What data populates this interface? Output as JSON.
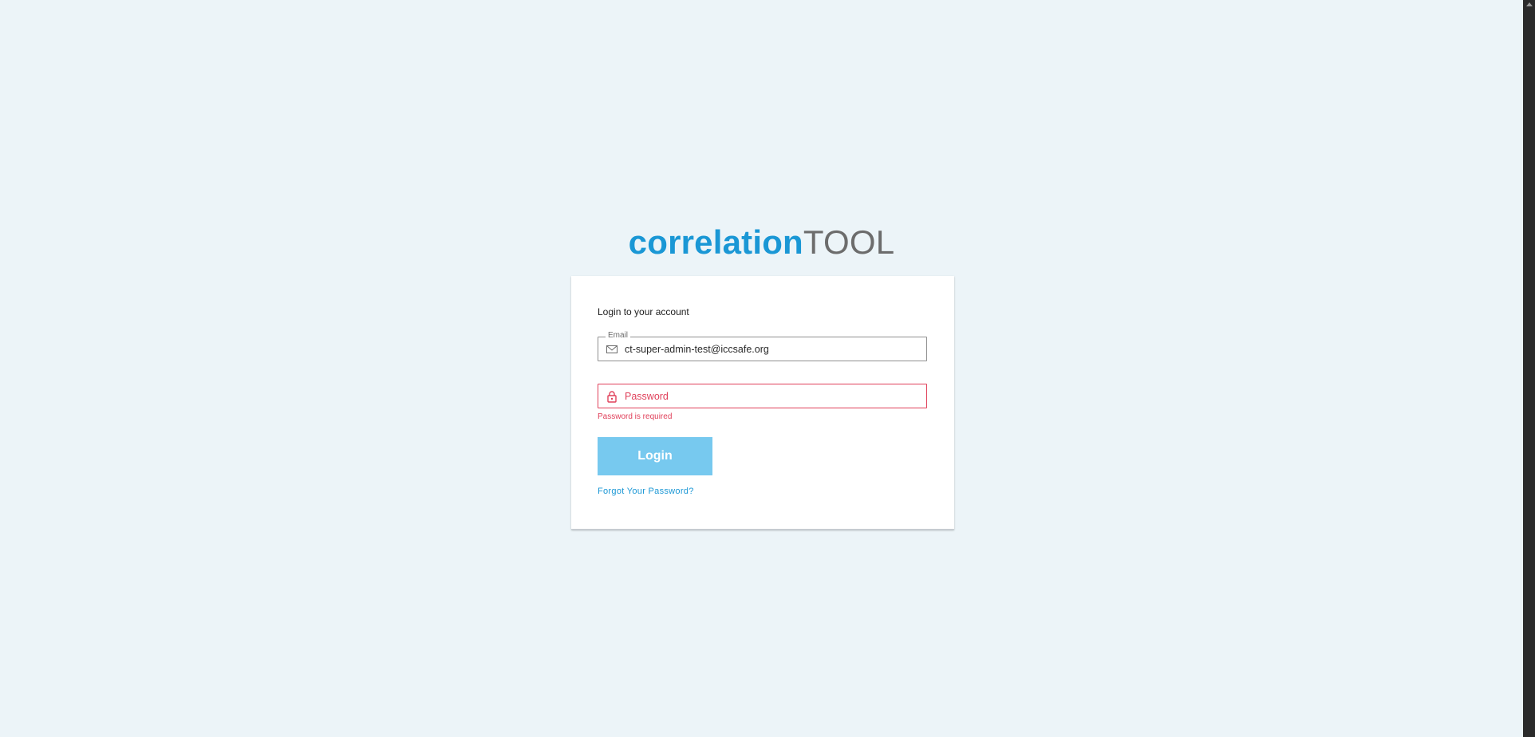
{
  "brand": {
    "main": "correlation",
    "sub": "TOOL"
  },
  "login": {
    "title": "Login to your account",
    "email": {
      "legend": "Email",
      "value": "ct-super-admin-test@iccsafe.org",
      "icon": "envelope-icon"
    },
    "password": {
      "placeholder": "Password",
      "value": "",
      "icon": "lock-icon",
      "error": "Password is required"
    },
    "submit_label": "Login",
    "forgot_label": "Forgot Your Password?"
  },
  "colors": {
    "background": "#ecf4f8",
    "accent": "#1a97d5",
    "button": "#77c9ef",
    "error": "#e0405a",
    "brand_sub": "#6c6c6c"
  }
}
